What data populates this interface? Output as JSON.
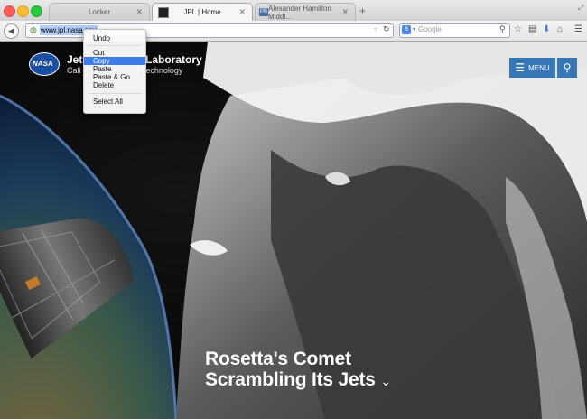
{
  "browser": {
    "tabs": [
      {
        "label": "Locker",
        "active": false
      },
      {
        "label": "JPL | Home",
        "active": true
      },
      {
        "label": "Alexander Hamilton Middl...",
        "active": false
      }
    ],
    "new_tab_symbol": "+",
    "url": "www.jpl.nasa.gov",
    "search_engine": "Google",
    "search_placeholder": "Google",
    "colors": {
      "close": "#ff5f57",
      "minimize": "#febc2e",
      "zoom": "#28c840"
    }
  },
  "context_menu": {
    "items": [
      "Undo",
      "Cut",
      "Copy",
      "Paste",
      "Paste & Go",
      "Delete",
      "Select All"
    ],
    "selected": "Copy"
  },
  "site": {
    "logo_text": "NASA",
    "org_line1": "Jet Propulsion Laboratory",
    "org_line1_visible": "Jet",
    "org_line1_tail": "Laboratory",
    "org_line2_head": "Cali",
    "org_line2_tail": "of Technology",
    "menu_label": "MENU",
    "headline_line1": "Rosetta's Comet",
    "headline_line2": "Scrambling Its Jets",
    "headline_chevron": "⌄",
    "accent": "#3777b6"
  }
}
